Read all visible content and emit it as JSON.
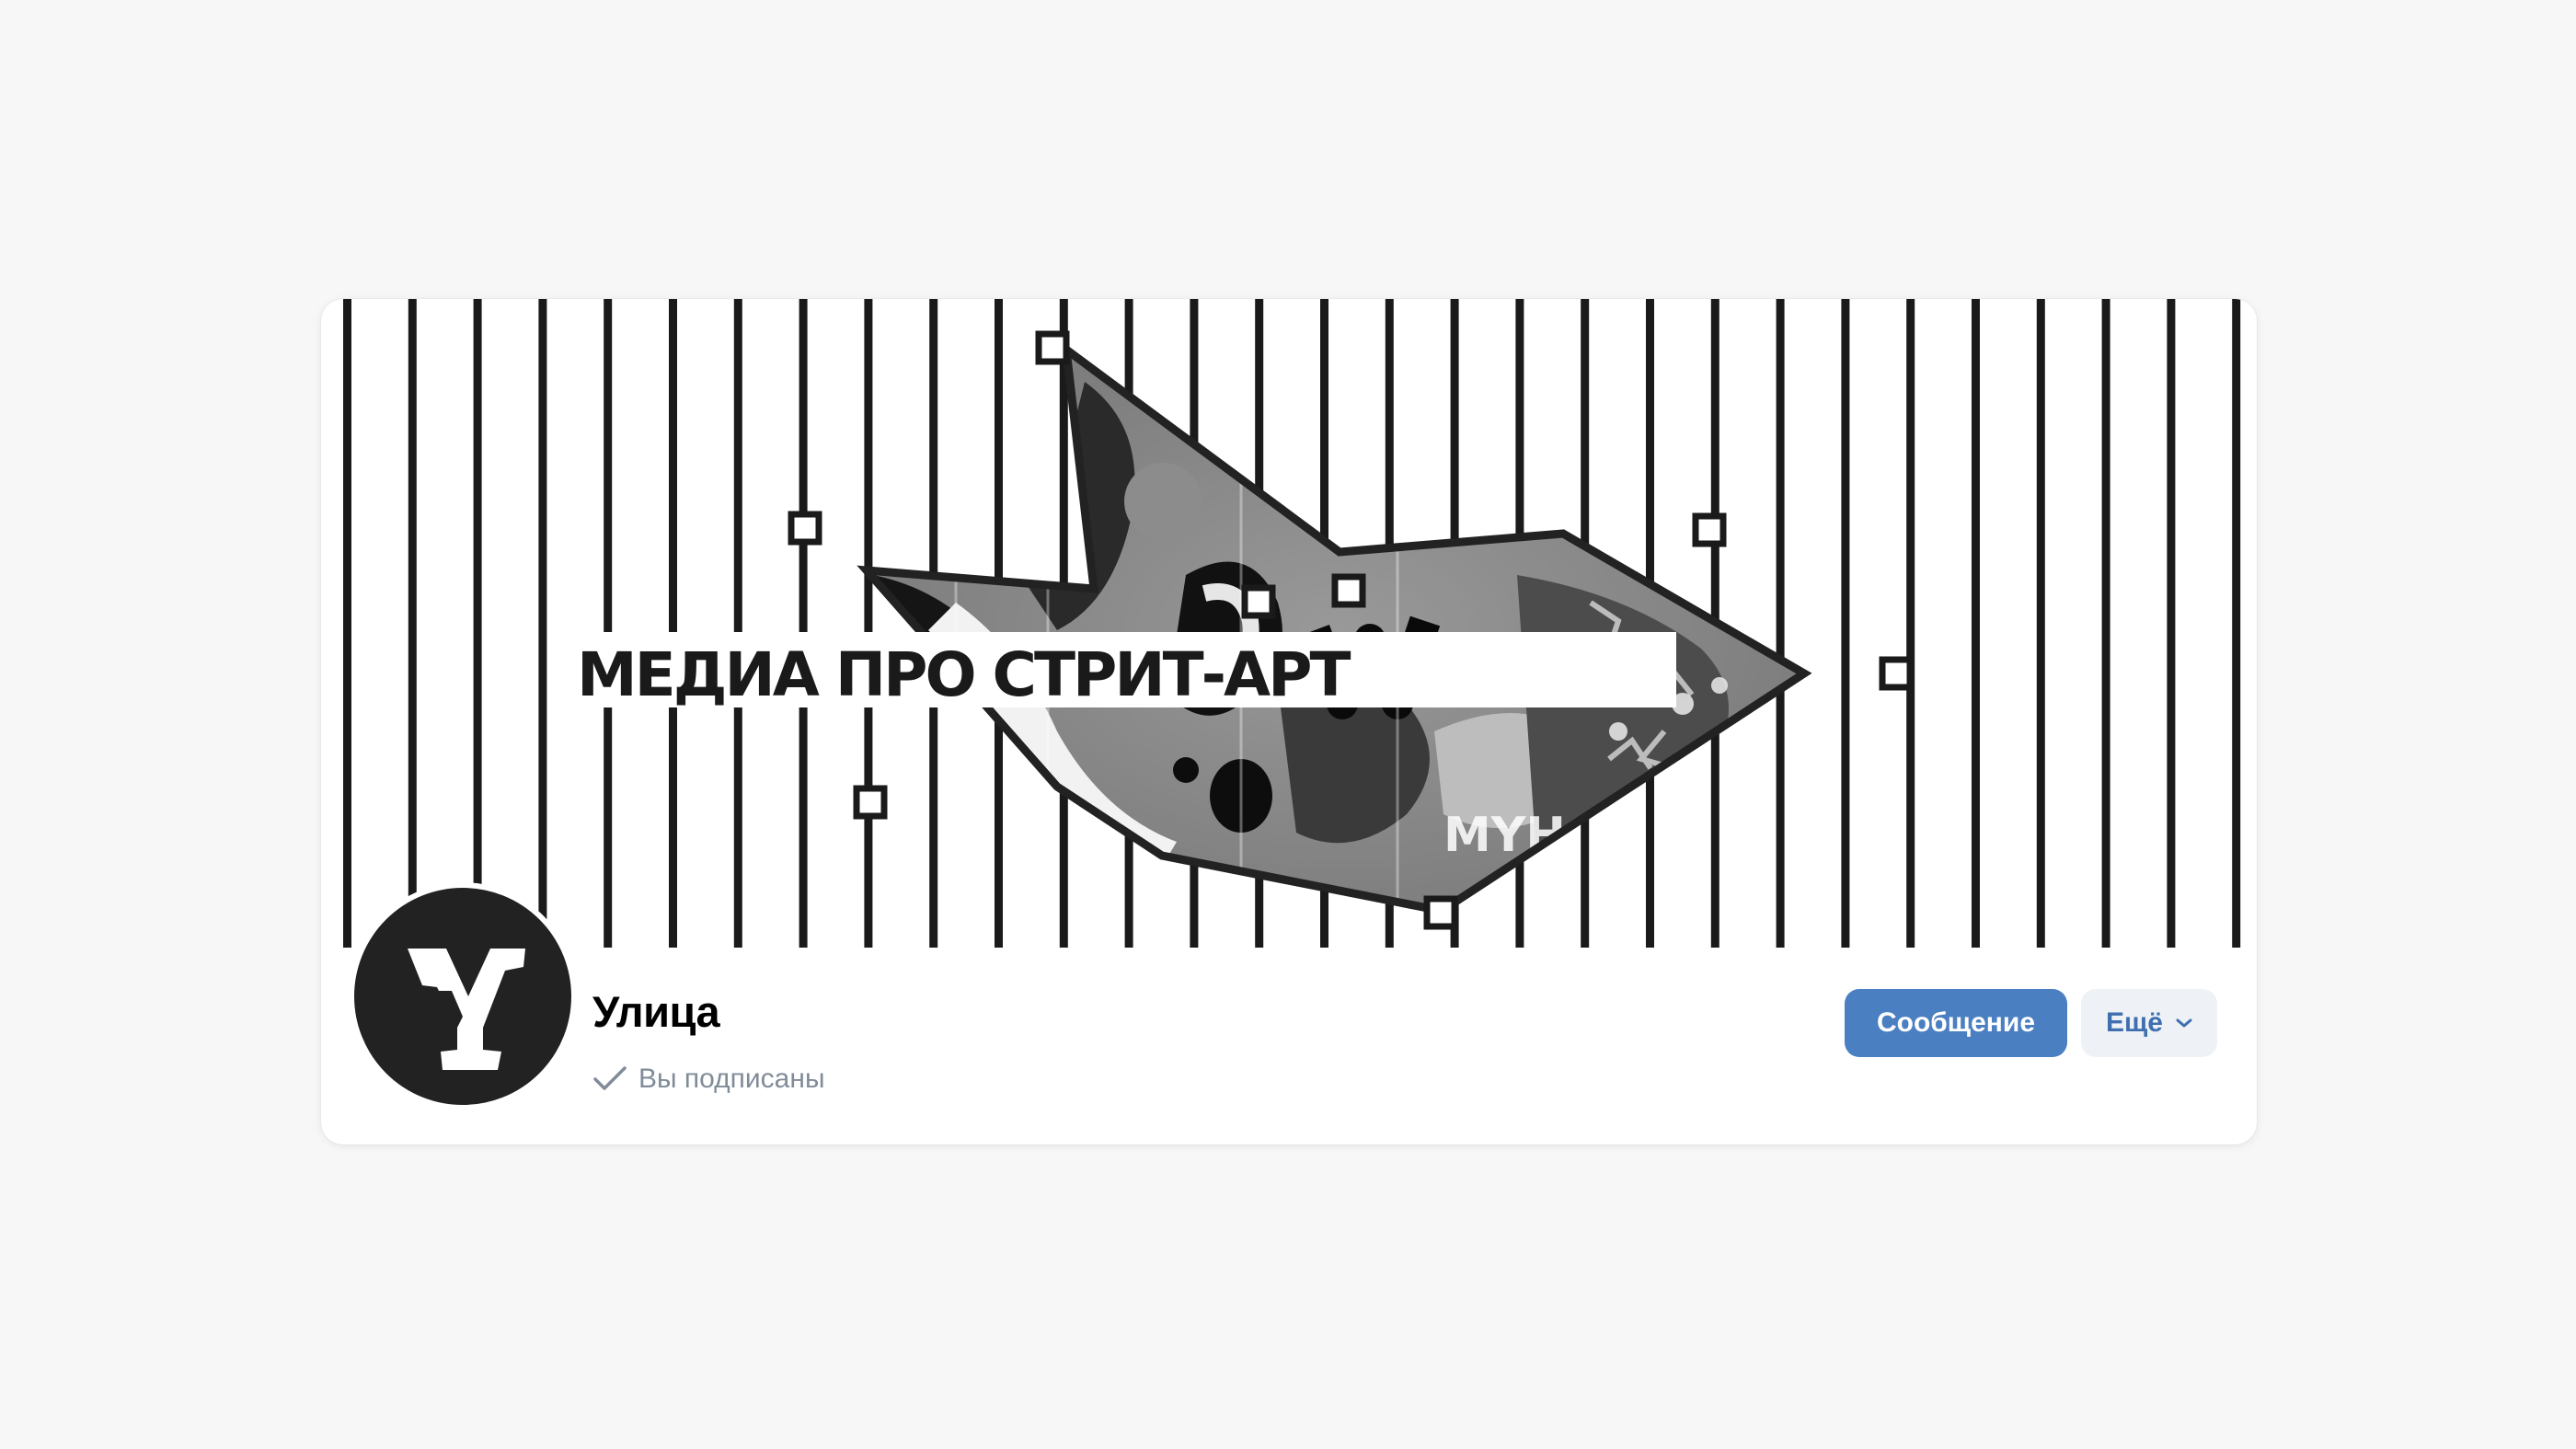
{
  "cover": {
    "headline": "МЕДИА ПРО СТРИТ-АРТ",
    "graffiti_tag": "MYH"
  },
  "community": {
    "name": "Улица",
    "subscription_status": "Вы подписаны"
  },
  "actions": {
    "message_label": "Сообщение",
    "more_label": "Ещё"
  },
  "icons": {
    "avatar": "community-logo-icon",
    "subscribed": "checkmark-icon",
    "more": "chevron-down-icon"
  },
  "colors": {
    "page_background": "#f7f7f7",
    "card_background": "#ffffff",
    "primary_button": "#4a7fc1",
    "secondary_button": "#eef1f5",
    "secondary_button_text": "#3f6fae",
    "muted_text": "#818c99",
    "stripes": "#1a1a1a"
  }
}
